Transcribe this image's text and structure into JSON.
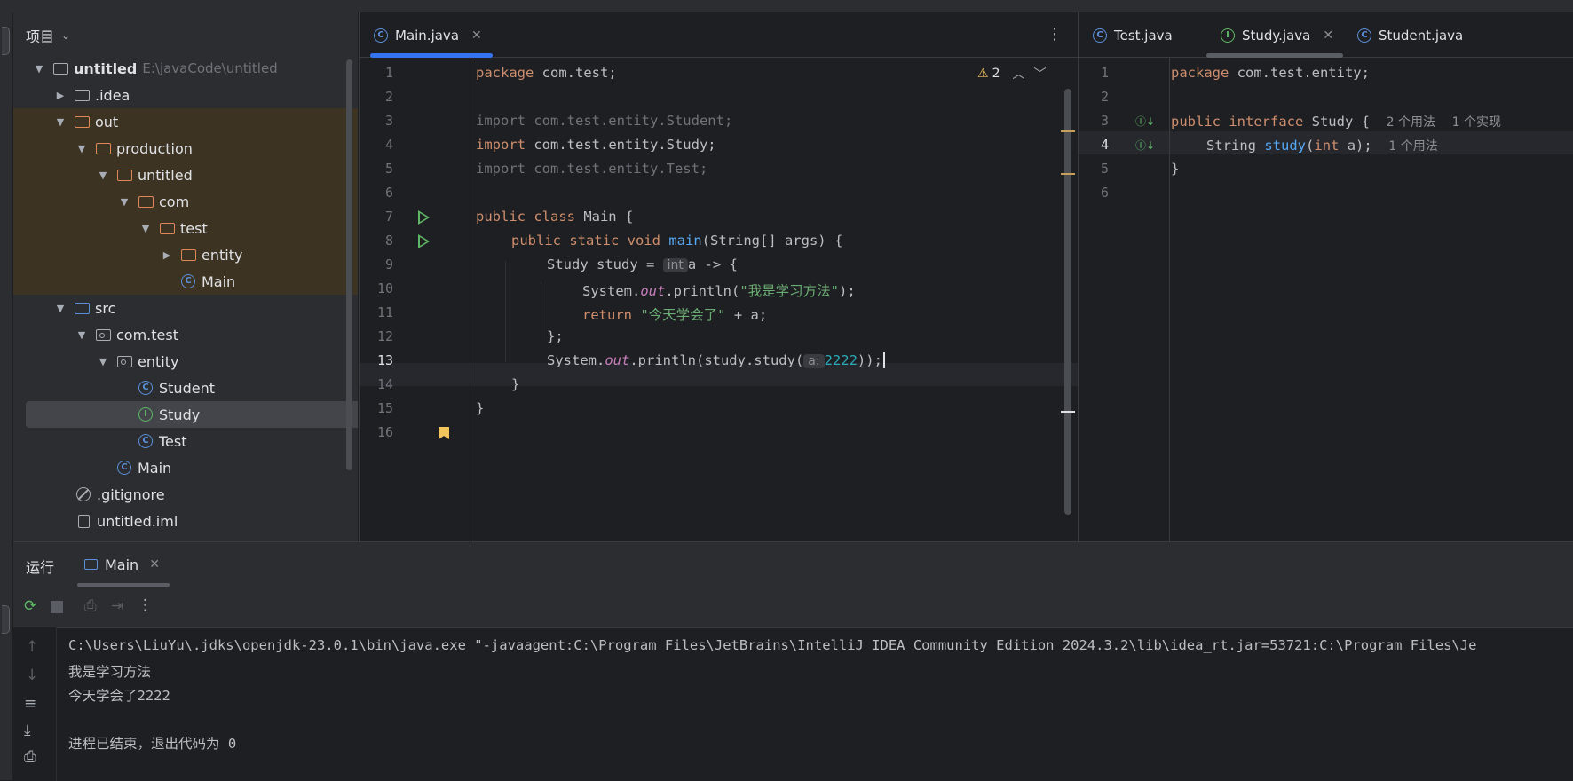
{
  "project_panel": {
    "title": "项目",
    "tree": [
      {
        "label": "untitled",
        "sub": "E:\\javaCode\\untitled"
      },
      {
        "label": ".idea"
      },
      {
        "label": "out"
      },
      {
        "label": "production"
      },
      {
        "label": "untitled"
      },
      {
        "label": "com"
      },
      {
        "label": "test"
      },
      {
        "label": "entity"
      },
      {
        "label": "Main"
      },
      {
        "label": "src"
      },
      {
        "label": "com.test"
      },
      {
        "label": "entity"
      },
      {
        "label": "Student"
      },
      {
        "label": "Study"
      },
      {
        "label": "Test"
      },
      {
        "label": "Main"
      },
      {
        "label": ".gitignore"
      },
      {
        "label": "untitled.iml"
      }
    ]
  },
  "main_editor": {
    "tab_label": "Main.java",
    "warnings_count": "2",
    "line_numbers": [
      "1",
      "2",
      "3",
      "4",
      "5",
      "6",
      "7",
      "8",
      "9",
      "10",
      "11",
      "12",
      "13",
      "14",
      "15",
      "16"
    ],
    "current_line": "13",
    "code": {
      "l1_kw": "package",
      "l1_rest": " com.test;",
      "l3": "import com.test.entity.Student;",
      "l4_kw": "import",
      "l4_rest": " com.test.entity.Study;",
      "l5": "import com.test.entity.Test;",
      "l7_kw": "public class",
      "l7_rest": " Main {",
      "l8_kw": "public static void",
      "l8_fn": "main",
      "l8_rest": "(String[] args) {",
      "l9_a": "Study study = ",
      "l9_hint": "int",
      "l9_b": "a -> {",
      "l10_a": "System.",
      "l10_out": "out",
      "l10_b": ".println(",
      "l10_str": "\"我是学习方法\"",
      "l10_c": ");",
      "l11_kw": "return",
      "l11_str": "\"今天学会了\"",
      "l11_rest": " + a;",
      "l12": "};",
      "l13_a": "System.",
      "l13_out": "out",
      "l13_b": ".println(study.study(",
      "l13_hint": "a:",
      "l13_num": "2222",
      "l13_c": "));",
      "l14": "}",
      "l15": "}"
    }
  },
  "right_editor": {
    "tabs": [
      "Test.java",
      "Study.java",
      "Student.java"
    ],
    "line_numbers": [
      "1",
      "2",
      "3",
      "4",
      "5",
      "6"
    ],
    "current_line": "4",
    "code": {
      "l1_kw": "package",
      "l1_rest": " com.test.entity;",
      "l3_kw": "public interface",
      "l3_rest": " Study {",
      "l3_usage1": "2 个用法",
      "l3_usage2": "1 个实现",
      "l4_type": "String",
      "l4_fn": "study",
      "l4_kw": "int",
      "l4_rest": " a);",
      "l4_usage": "1 个用法",
      "l5": "}"
    }
  },
  "run_panel": {
    "title": "运行",
    "tab_label": "Main",
    "console": [
      "C:\\Users\\LiuYu\\.jdks\\openjdk-23.0.1\\bin\\java.exe \"-javaagent:C:\\Program Files\\JetBrains\\IntelliJ IDEA Community Edition 2024.3.2\\lib\\idea_rt.jar=53721:C:\\Program Files\\Je",
      "我是学习方法",
      "今天学会了2222",
      "",
      "进程已结束，退出代码为 0"
    ]
  },
  "colors": {
    "accent": "#3574f0",
    "keyword": "#cf8e6d",
    "string": "#6aab73",
    "function": "#56a8f5",
    "number": "#2aacb8"
  }
}
